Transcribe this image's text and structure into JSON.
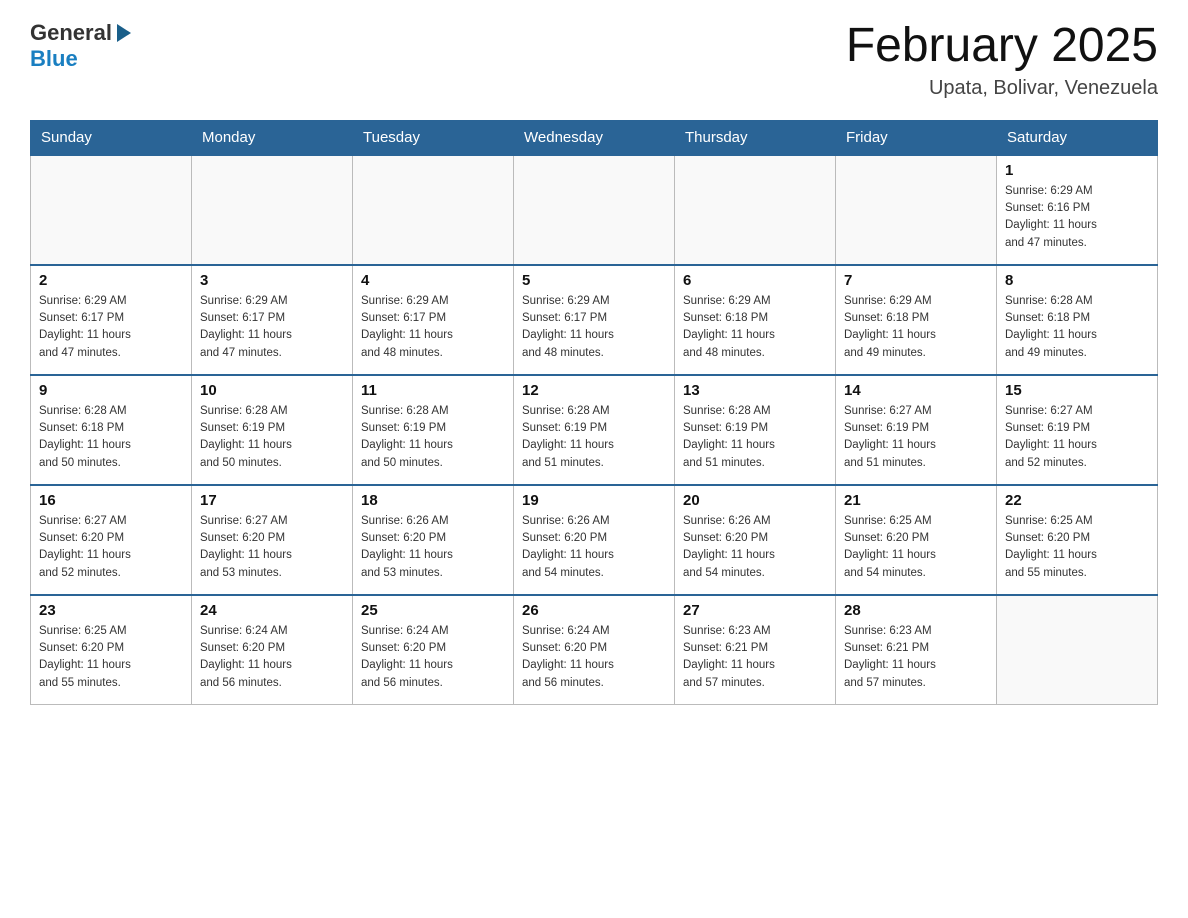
{
  "header": {
    "logo_general": "General",
    "logo_blue": "Blue",
    "month_title": "February 2025",
    "location": "Upata, Bolivar, Venezuela"
  },
  "weekdays": [
    "Sunday",
    "Monday",
    "Tuesday",
    "Wednesday",
    "Thursday",
    "Friday",
    "Saturday"
  ],
  "weeks": [
    [
      {
        "day": "",
        "info": ""
      },
      {
        "day": "",
        "info": ""
      },
      {
        "day": "",
        "info": ""
      },
      {
        "day": "",
        "info": ""
      },
      {
        "day": "",
        "info": ""
      },
      {
        "day": "",
        "info": ""
      },
      {
        "day": "1",
        "info": "Sunrise: 6:29 AM\nSunset: 6:16 PM\nDaylight: 11 hours\nand 47 minutes."
      }
    ],
    [
      {
        "day": "2",
        "info": "Sunrise: 6:29 AM\nSunset: 6:17 PM\nDaylight: 11 hours\nand 47 minutes."
      },
      {
        "day": "3",
        "info": "Sunrise: 6:29 AM\nSunset: 6:17 PM\nDaylight: 11 hours\nand 47 minutes."
      },
      {
        "day": "4",
        "info": "Sunrise: 6:29 AM\nSunset: 6:17 PM\nDaylight: 11 hours\nand 48 minutes."
      },
      {
        "day": "5",
        "info": "Sunrise: 6:29 AM\nSunset: 6:17 PM\nDaylight: 11 hours\nand 48 minutes."
      },
      {
        "day": "6",
        "info": "Sunrise: 6:29 AM\nSunset: 6:18 PM\nDaylight: 11 hours\nand 48 minutes."
      },
      {
        "day": "7",
        "info": "Sunrise: 6:29 AM\nSunset: 6:18 PM\nDaylight: 11 hours\nand 49 minutes."
      },
      {
        "day": "8",
        "info": "Sunrise: 6:28 AM\nSunset: 6:18 PM\nDaylight: 11 hours\nand 49 minutes."
      }
    ],
    [
      {
        "day": "9",
        "info": "Sunrise: 6:28 AM\nSunset: 6:18 PM\nDaylight: 11 hours\nand 50 minutes."
      },
      {
        "day": "10",
        "info": "Sunrise: 6:28 AM\nSunset: 6:19 PM\nDaylight: 11 hours\nand 50 minutes."
      },
      {
        "day": "11",
        "info": "Sunrise: 6:28 AM\nSunset: 6:19 PM\nDaylight: 11 hours\nand 50 minutes."
      },
      {
        "day": "12",
        "info": "Sunrise: 6:28 AM\nSunset: 6:19 PM\nDaylight: 11 hours\nand 51 minutes."
      },
      {
        "day": "13",
        "info": "Sunrise: 6:28 AM\nSunset: 6:19 PM\nDaylight: 11 hours\nand 51 minutes."
      },
      {
        "day": "14",
        "info": "Sunrise: 6:27 AM\nSunset: 6:19 PM\nDaylight: 11 hours\nand 51 minutes."
      },
      {
        "day": "15",
        "info": "Sunrise: 6:27 AM\nSunset: 6:19 PM\nDaylight: 11 hours\nand 52 minutes."
      }
    ],
    [
      {
        "day": "16",
        "info": "Sunrise: 6:27 AM\nSunset: 6:20 PM\nDaylight: 11 hours\nand 52 minutes."
      },
      {
        "day": "17",
        "info": "Sunrise: 6:27 AM\nSunset: 6:20 PM\nDaylight: 11 hours\nand 53 minutes."
      },
      {
        "day": "18",
        "info": "Sunrise: 6:26 AM\nSunset: 6:20 PM\nDaylight: 11 hours\nand 53 minutes."
      },
      {
        "day": "19",
        "info": "Sunrise: 6:26 AM\nSunset: 6:20 PM\nDaylight: 11 hours\nand 54 minutes."
      },
      {
        "day": "20",
        "info": "Sunrise: 6:26 AM\nSunset: 6:20 PM\nDaylight: 11 hours\nand 54 minutes."
      },
      {
        "day": "21",
        "info": "Sunrise: 6:25 AM\nSunset: 6:20 PM\nDaylight: 11 hours\nand 54 minutes."
      },
      {
        "day": "22",
        "info": "Sunrise: 6:25 AM\nSunset: 6:20 PM\nDaylight: 11 hours\nand 55 minutes."
      }
    ],
    [
      {
        "day": "23",
        "info": "Sunrise: 6:25 AM\nSunset: 6:20 PM\nDaylight: 11 hours\nand 55 minutes."
      },
      {
        "day": "24",
        "info": "Sunrise: 6:24 AM\nSunset: 6:20 PM\nDaylight: 11 hours\nand 56 minutes."
      },
      {
        "day": "25",
        "info": "Sunrise: 6:24 AM\nSunset: 6:20 PM\nDaylight: 11 hours\nand 56 minutes."
      },
      {
        "day": "26",
        "info": "Sunrise: 6:24 AM\nSunset: 6:20 PM\nDaylight: 11 hours\nand 56 minutes."
      },
      {
        "day": "27",
        "info": "Sunrise: 6:23 AM\nSunset: 6:21 PM\nDaylight: 11 hours\nand 57 minutes."
      },
      {
        "day": "28",
        "info": "Sunrise: 6:23 AM\nSunset: 6:21 PM\nDaylight: 11 hours\nand 57 minutes."
      },
      {
        "day": "",
        "info": ""
      }
    ]
  ]
}
